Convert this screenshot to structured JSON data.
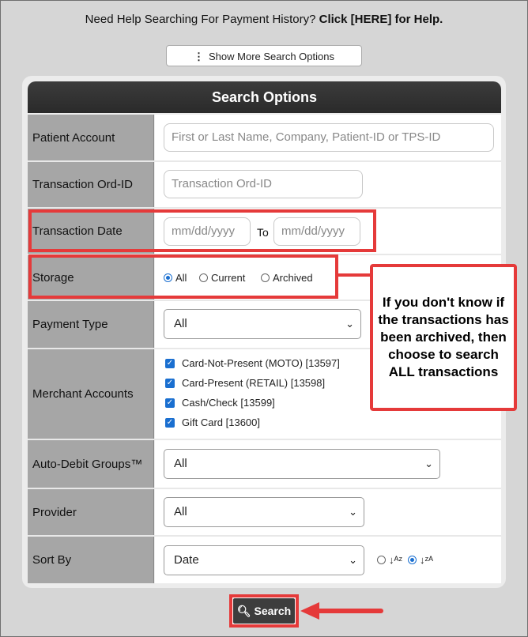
{
  "help": {
    "prefix": "Need Help Searching For Payment History? ",
    "link": "Click [HERE] for Help."
  },
  "more_options_button": "Show More Search Options",
  "panel_title": "Search Options",
  "fields": {
    "patient_account": {
      "label": "Patient Account",
      "placeholder": "First or Last Name, Company, Patient-ID or TPS-ID"
    },
    "transaction_ord_id": {
      "label": "Transaction Ord-ID",
      "placeholder": "Transaction Ord-ID"
    },
    "transaction_date": {
      "label": "Transaction Date",
      "from_placeholder": "mm/dd/yyyy",
      "to_label": "To",
      "to_placeholder": "mm/dd/yyyy"
    },
    "storage": {
      "label": "Storage",
      "options": [
        "All",
        "Current",
        "Archived"
      ],
      "selected": "All"
    },
    "payment_type": {
      "label": "Payment Type",
      "value": "All"
    },
    "merchant_accounts": {
      "label": "Merchant Accounts",
      "items": [
        "Card-Not-Present (MOTO) [13597]",
        "Card-Present (RETAIL) [13598]",
        "Cash/Check [13599]",
        "Gift Card [13600]"
      ]
    },
    "auto_debit_groups": {
      "label": "Auto-Debit Groups™",
      "value": "All"
    },
    "provider": {
      "label": "Provider",
      "value": "All"
    },
    "sort_by": {
      "label": "Sort By",
      "value": "Date",
      "order_selected": "descending"
    }
  },
  "callout_text": "If you don't know if the transactions has been archived, then choose to search ALL transactions",
  "search_button": "Search",
  "colors": {
    "highlight": "#e53a3a",
    "header": "#333333",
    "checkbox": "#1a6fd0"
  }
}
